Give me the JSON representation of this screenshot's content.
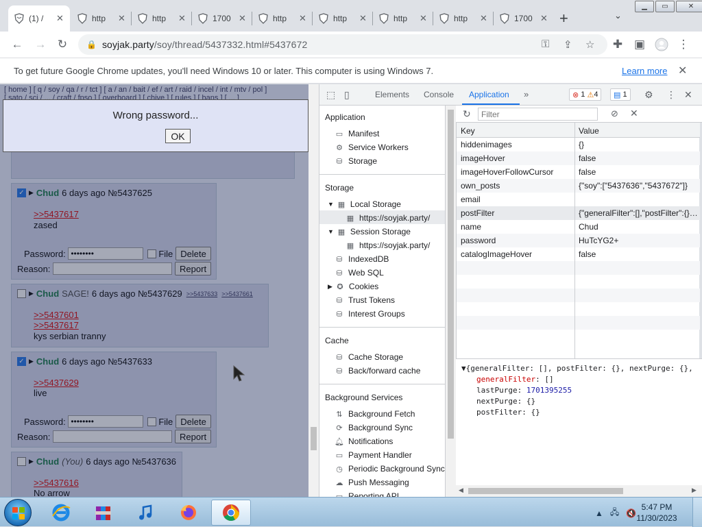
{
  "tabs": [
    {
      "title": "(1) /",
      "active": true
    },
    {
      "title": "http"
    },
    {
      "title": "http"
    },
    {
      "title": "1700"
    },
    {
      "title": "http"
    },
    {
      "title": "http"
    },
    {
      "title": "http"
    },
    {
      "title": "http"
    },
    {
      "title": "1700"
    }
  ],
  "toolbar": {
    "url_host": "soyjak.party",
    "url_path": "/soy/thread/5437332.html#5437672"
  },
  "infobar": {
    "message": "To get future Google Chrome updates, you'll need Windows 10 or later. This computer is using Windows 7.",
    "learn_more": "Learn more"
  },
  "page": {
    "nav_line1": "[ home ] [ q / soy / qa / r / tct ] [ a / an / bait / ef / art / raid / incel / int / mtv / pol ]",
    "nav_line2": "[ sato / sci / ... / craft / fpso ] [ overboard ] [ chive ] [ rules ] [ bans ] [ ... ]",
    "dialog": {
      "message": "Wrong password...",
      "ok": "OK"
    },
    "posts": [
      {
        "name": "Chud",
        "date": "6 days ago",
        "no": "№5437625",
        "checked": true,
        "refs": [
          ">>5437617"
        ],
        "body": "zased",
        "delete_form": true
      },
      {
        "name": "Chud",
        "sage": "SAGE!",
        "date": "6 days ago",
        "no": "№5437629",
        "checked": false,
        "backlinks": [
          ">>5437633",
          ">>5437661"
        ],
        "refs": [
          ">>5437601",
          ">>5437617"
        ],
        "body": "kys serbian tranny",
        "delete_form": false
      },
      {
        "name": "Chud",
        "date": "6 days ago",
        "no": "№5437633",
        "checked": true,
        "refs": [
          ">>5437629"
        ],
        "body": "live",
        "delete_form": true
      },
      {
        "name": "Chud",
        "you": "(You)",
        "date": "6 days ago",
        "no": "№5437636",
        "checked": false,
        "refs": [
          ">>5437616"
        ],
        "body": "No arrow",
        "delete_form": false
      }
    ],
    "delete_form": {
      "password_label": "Password:",
      "password_value": "••••••••",
      "file_label": "File",
      "delete_btn": "Delete",
      "reason_label": "Reason:",
      "report_btn": "Report"
    }
  },
  "devtools": {
    "tabs": [
      "Elements",
      "Console",
      "Application"
    ],
    "active_tab": "Application",
    "badges": {
      "errors": "1",
      "warnings": "4",
      "messages": "1"
    },
    "sidebar": {
      "application_header": "Application",
      "application_items": [
        "Manifest",
        "Service Workers",
        "Storage"
      ],
      "storage_header": "Storage",
      "storage_items": [
        "Local Storage",
        "https://soyjak.party/",
        "Session Storage",
        "https://soyjak.party/",
        "IndexedDB",
        "Web SQL",
        "Cookies",
        "Trust Tokens",
        "Interest Groups"
      ],
      "cache_header": "Cache",
      "cache_items": [
        "Cache Storage",
        "Back/forward cache"
      ],
      "bg_header": "Background Services",
      "bg_items": [
        "Background Fetch",
        "Background Sync",
        "Notifications",
        "Payment Handler",
        "Periodic Background Sync",
        "Push Messaging",
        "Reporting API"
      ]
    },
    "filter_placeholder": "Filter",
    "table_headers": {
      "key": "Key",
      "value": "Value"
    },
    "rows": [
      {
        "key": "hiddenimages",
        "value": "{}"
      },
      {
        "key": "imageHover",
        "value": "false"
      },
      {
        "key": "imageHoverFollowCursor",
        "value": "false"
      },
      {
        "key": "own_posts",
        "value": "{\"soy\":[\"5437636\",\"5437672\"]}"
      },
      {
        "key": "email",
        "value": ""
      },
      {
        "key": "postFilter",
        "value": "{\"generalFilter\":[],\"postFilter\":{},\"nextPurge\":..."
      },
      {
        "key": "name",
        "value": "Chud"
      },
      {
        "key": "password",
        "value": "HuTcYG2+"
      },
      {
        "key": "catalogImageHover",
        "value": "false"
      }
    ],
    "selected_row": 5,
    "preview": {
      "summary": "{generalFilter: [], postFilter: {}, nextPurge: {},",
      "lines": [
        {
          "k": "generalFilter",
          "v": "[]"
        },
        {
          "k": "lastPurge",
          "v": "1701395255"
        },
        {
          "k": "nextPurge",
          "v": "{}"
        },
        {
          "k": "postFilter",
          "v": "{}"
        }
      ]
    }
  },
  "taskbar": {
    "time": "5:47 PM",
    "date": "11/30/2023"
  }
}
